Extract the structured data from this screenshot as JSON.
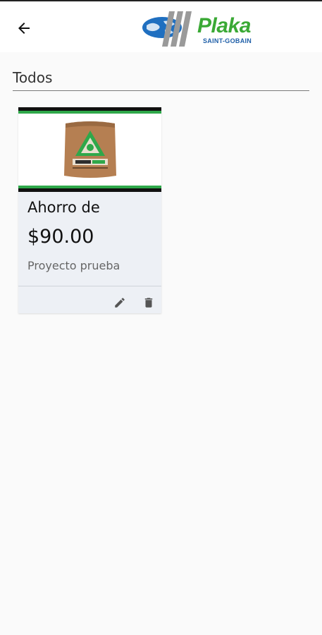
{
  "header": {
    "back_icon": "arrow-left-icon",
    "logo": {
      "word": "Plaka",
      "sub": "SAINT-GOBAIN"
    }
  },
  "filter": {
    "label": "Todos"
  },
  "cards": [
    {
      "title": "Ahorro de",
      "amount": "$90.00",
      "project": "Proyecto prueba",
      "actions": [
        "edit-icon",
        "delete-icon"
      ]
    }
  ],
  "colors": {
    "brand_green": "#3aa935",
    "brand_blue": "#1f5fa8",
    "card_background": "#edf0f5"
  }
}
